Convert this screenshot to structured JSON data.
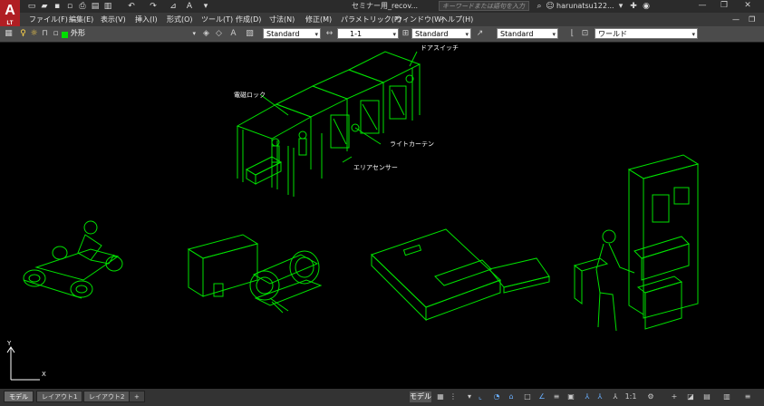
{
  "app": {
    "logo": "A",
    "logo_sub": "LT",
    "title": "セミナー用_recov...",
    "search_placeholder": "キーワードまたは語句を入力",
    "user": "harunatsu122...",
    "minimize": "—",
    "maximize": "❐",
    "close": "✕"
  },
  "menu": [
    "ファイル(F)",
    "編集(E)",
    "表示(V)",
    "挿入(I)",
    "形式(O)",
    "ツール(T)",
    "作成(D)",
    "寸法(N)",
    "修正(M)",
    "パラメトリック(P)",
    "ウィンドウ(W)",
    "ヘルプ(H)"
  ],
  "toolbar": {
    "layer": "外形",
    "textstyle": "Standard",
    "dimscale": "1-1",
    "dimstyle": "Standard",
    "tablestyle": "Standard",
    "ucs": "ワールド"
  },
  "labels": {
    "door_switch": "ドアスイッチ",
    "mag_lock": "電磁ロック",
    "light_curtain": "ライトカーテン",
    "area_sensor": "エリアセンサー"
  },
  "ucs_icon": {
    "x": "X",
    "y": "Y"
  },
  "tabs": [
    "モデル",
    "レイアウト1",
    "レイアウト2",
    "+"
  ],
  "status": {
    "mode": "モデル",
    "scale": "1:1"
  },
  "colors": {
    "wire": "#00e000",
    "bg": "#000000"
  }
}
